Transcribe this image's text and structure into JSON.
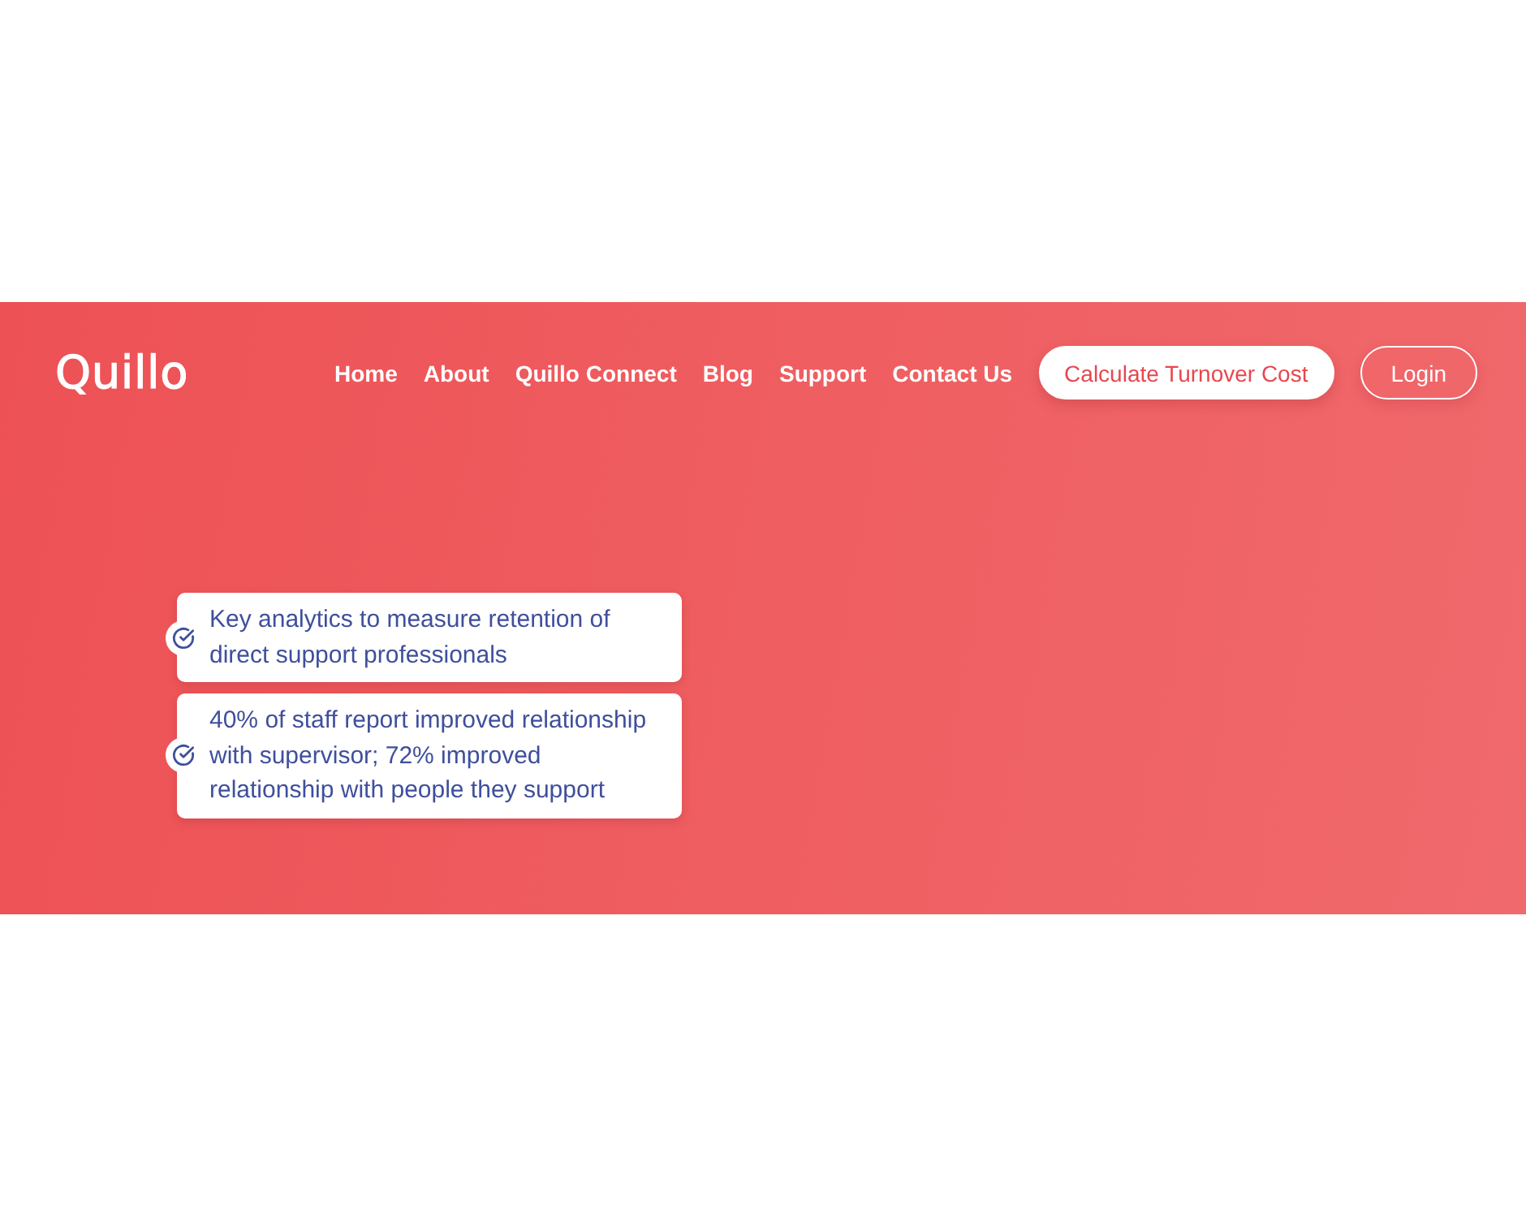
{
  "logo": {
    "text": "Quillo"
  },
  "nav": {
    "links": [
      "Home",
      "About",
      "Quillo Connect",
      "Blog",
      "Support",
      "Contact Us"
    ],
    "buttons": [
      {
        "label": "Calculate Turnover Cost",
        "kind": "primary"
      },
      {
        "label": "Login",
        "kind": "outline"
      }
    ]
  },
  "features": [
    {
      "text": "Key analytics to measure retention of direct support professionals"
    },
    {
      "text": "40% of staff report improved relationship with supervisor; 72% improved relationship with people they support"
    }
  ]
}
